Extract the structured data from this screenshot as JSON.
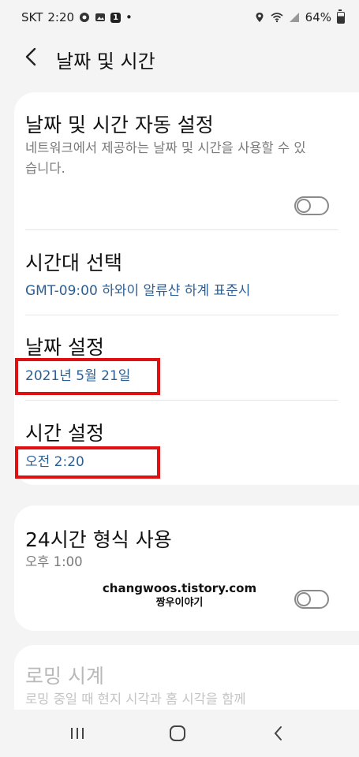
{
  "status": {
    "carrier": "SKT",
    "time": "2:20",
    "notif_badge": "1",
    "dot": "•",
    "battery": "64%"
  },
  "appbar": {
    "title": "날짜 및 시간"
  },
  "auto_setting": {
    "title": "날짜 및 시간 자동 설정",
    "subtitle": "네트워크에서 제공하는 날짜 및 시간을 사용할 수 있습니다.",
    "enabled": false
  },
  "timezone": {
    "title": "시간대 선택",
    "value": "GMT-09:00 하와이 알류샨 하계 표준시"
  },
  "date_setting": {
    "title": "날짜 설정",
    "value": "2021년 5월 21일"
  },
  "time_setting": {
    "title": "시간 설정",
    "value": "오전 2:20"
  },
  "format24": {
    "title": "24시간 형식 사용",
    "subtitle": "오후 1:00",
    "enabled": false
  },
  "watermark": {
    "line1": "changwoos.tistory.com",
    "line2": "짱우이야기"
  },
  "roaming": {
    "title": "로밍 시계",
    "subtitle": "로밍 중일 때 현지 시각과 홈 시각을 함께"
  },
  "colors": {
    "accent_value": "#2c5f94",
    "highlight": "#e01010",
    "background": "#f4f4f4"
  },
  "icons": [
    "back-arrow-icon",
    "recent-apps-icon",
    "home-icon",
    "back-nav-icon",
    "wifi-icon",
    "location-icon",
    "battery-icon"
  ]
}
